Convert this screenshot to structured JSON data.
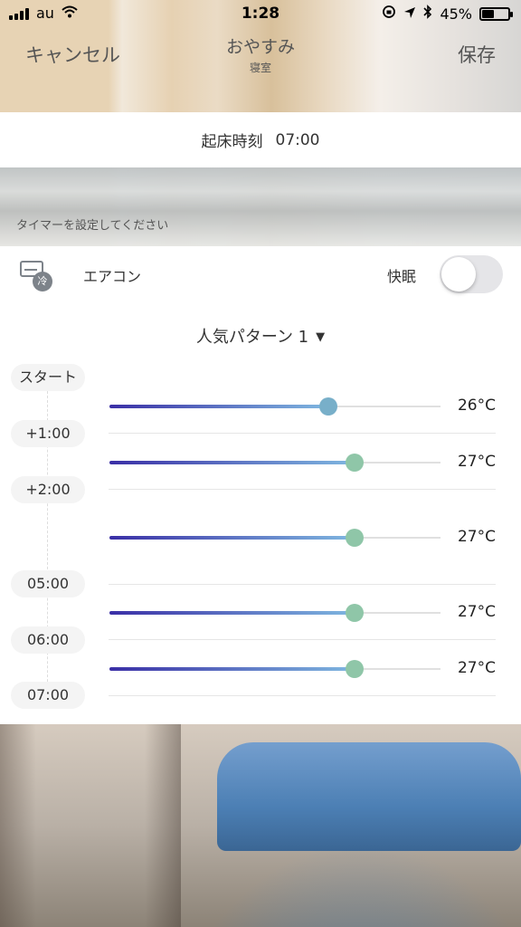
{
  "status": {
    "carrier": "au",
    "time": "1:28",
    "battery": "45%",
    "battery_level": 0.45
  },
  "nav": {
    "cancel": "キャンセル",
    "title": "おやすみ",
    "subtitle": "寝室",
    "save": "保存"
  },
  "wake": {
    "label": "起床時刻",
    "time": "07:00"
  },
  "timer_hint": "タイマーを設定してください",
  "ac": {
    "label": "エアコン",
    "mode_badge": "冷",
    "sleep_label": "快眠",
    "sleep_on": false
  },
  "pattern": {
    "label": "人気パターン 1"
  },
  "times": [
    "スタート",
    "+1:00",
    "+2:00",
    "05:00",
    "06:00",
    "07:00"
  ],
  "settings": [
    {
      "temp": "26°C",
      "level": 0.66,
      "thumb_color": "#78afc9"
    },
    {
      "temp": "27°C",
      "level": 0.74,
      "thumb_color": "#8fc6a8"
    },
    {
      "temp": "27°C",
      "level": 0.74,
      "thumb_color": "#8fc6a8"
    },
    {
      "temp": "27°C",
      "level": 0.74,
      "thumb_color": "#8fc6a8"
    },
    {
      "temp": "27°C",
      "level": 0.74,
      "thumb_color": "#8fc6a8"
    }
  ],
  "colors": {
    "track_start": "#3a2fa6",
    "track_end": "#7fb7e0"
  }
}
